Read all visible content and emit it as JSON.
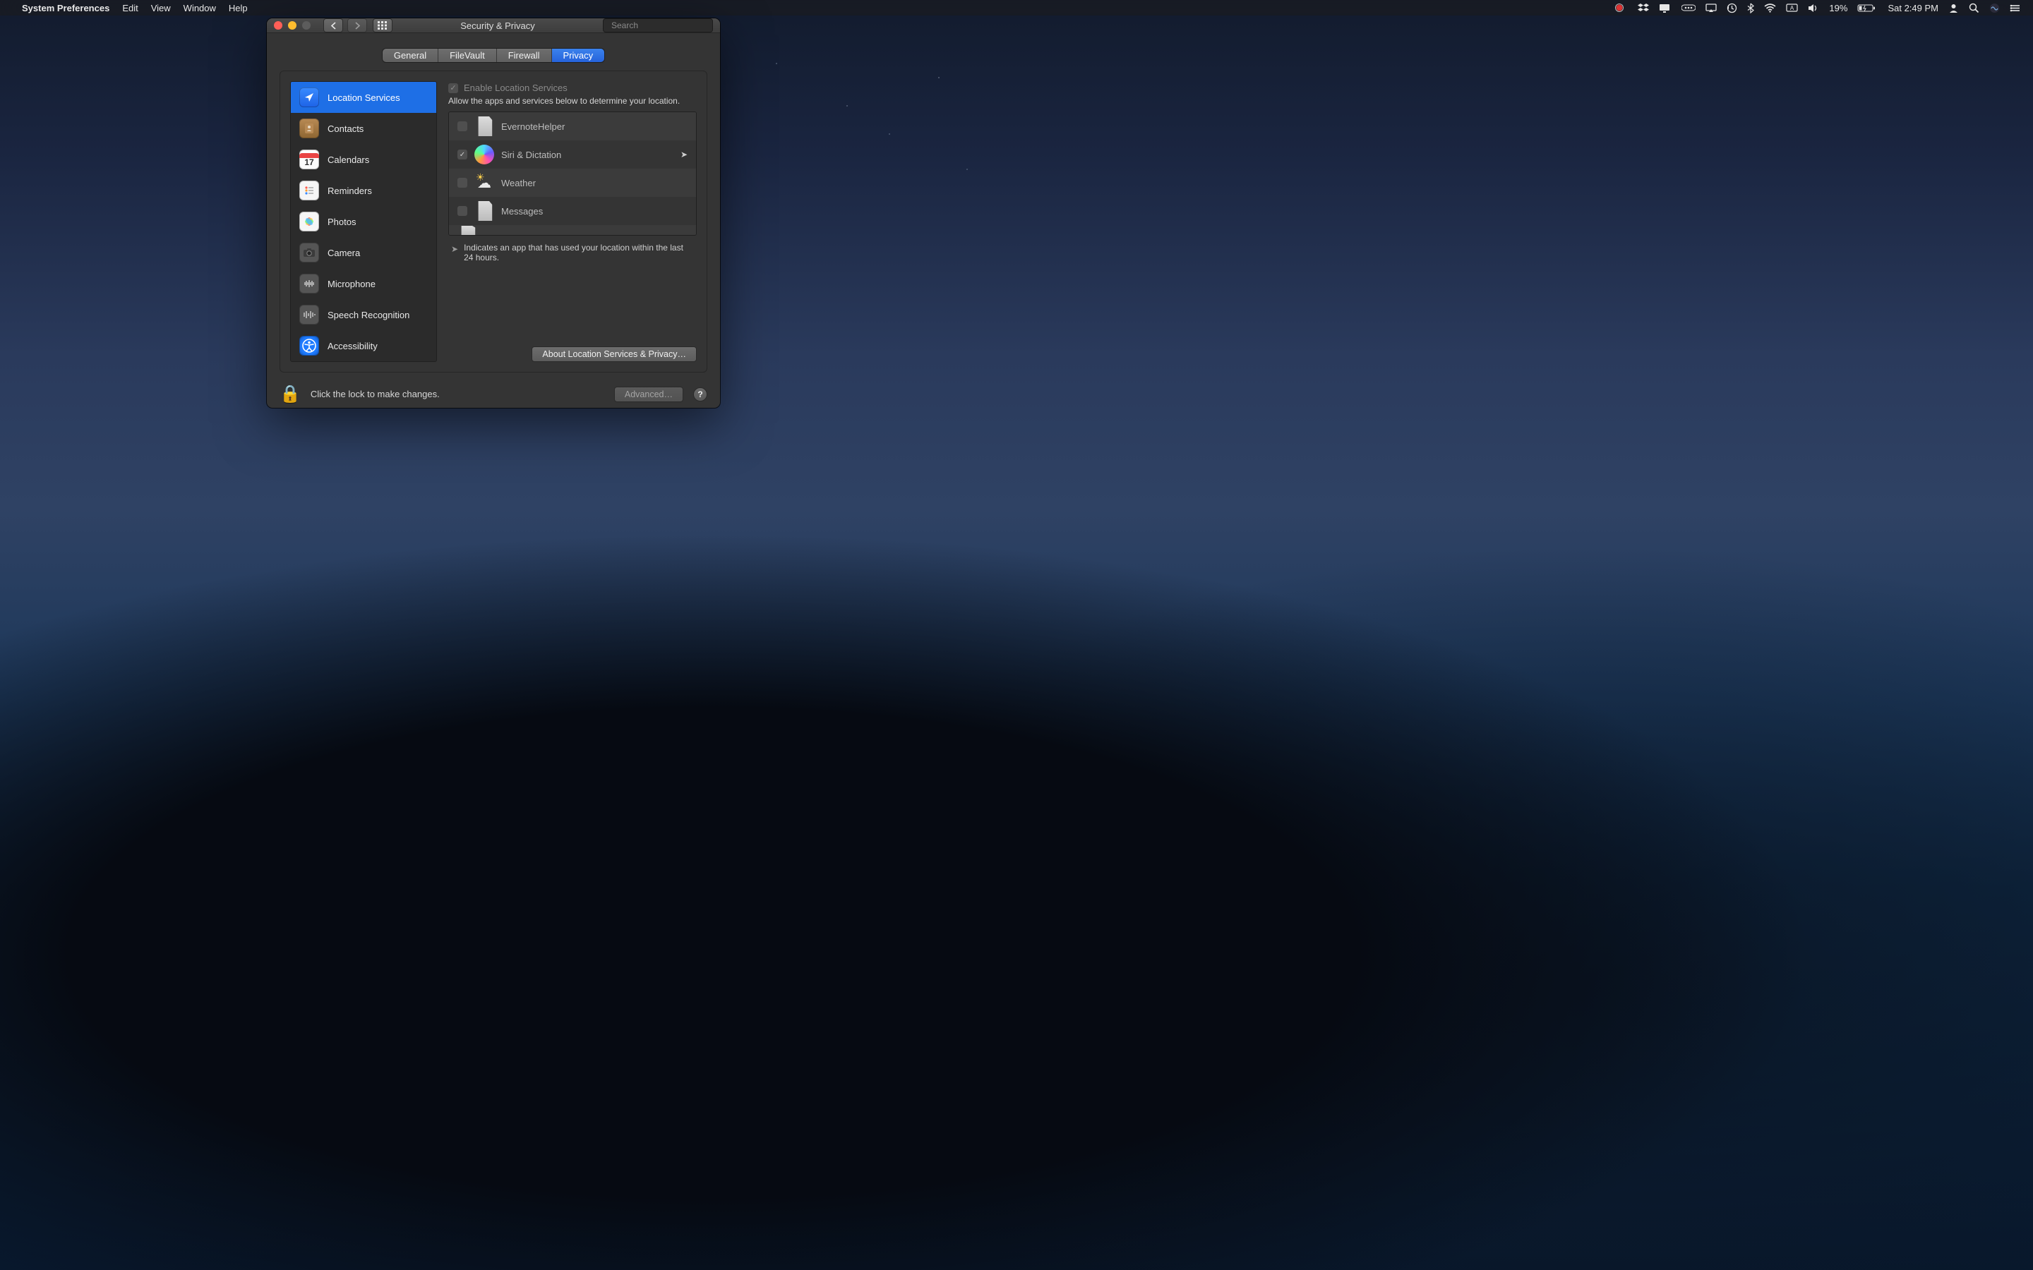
{
  "menubar": {
    "app_name": "System Preferences",
    "items": [
      "Edit",
      "View",
      "Window",
      "Help"
    ],
    "battery_text": "19%",
    "clock_text": "Sat 2:49 PM"
  },
  "window": {
    "title": "Security & Privacy",
    "search_placeholder": "Search",
    "tabs": {
      "general": "General",
      "filevault": "FileVault",
      "firewall": "Firewall",
      "privacy": "Privacy"
    },
    "sidebar": {
      "items": [
        {
          "label": "Location Services"
        },
        {
          "label": "Contacts"
        },
        {
          "label": "Calendars"
        },
        {
          "label": "Reminders"
        },
        {
          "label": "Photos"
        },
        {
          "label": "Camera"
        },
        {
          "label": "Microphone"
        },
        {
          "label": "Speech Recognition"
        },
        {
          "label": "Accessibility"
        }
      ]
    },
    "right": {
      "enable_label": "Enable Location Services",
      "enable_desc": "Allow the apps and services below to determine your location.",
      "apps": [
        {
          "name": "EvernoteHelper",
          "checked": false,
          "recent": false
        },
        {
          "name": "Siri & Dictation",
          "checked": true,
          "recent": true
        },
        {
          "name": "Weather",
          "checked": false,
          "recent": false
        },
        {
          "name": "Messages",
          "checked": false,
          "recent": false
        }
      ],
      "legend": "Indicates an app that has used your location within the last 24 hours.",
      "about_button": "About Location Services & Privacy…"
    },
    "footer": {
      "lock_text": "Click the lock to make changes.",
      "advanced": "Advanced…"
    }
  }
}
